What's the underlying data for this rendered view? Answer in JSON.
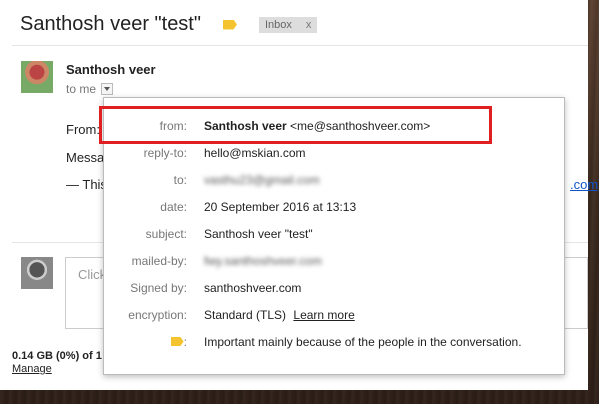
{
  "email": {
    "subject": "Santhosh veer \"test\"",
    "label_chip": "Inbox",
    "label_chip_close": "x",
    "sender_name": "Santhosh veer",
    "to_text": "to me",
    "body_from": "From:",
    "body_message": "Messa",
    "body_this": "— This",
    "body_link_tail": ".com)"
  },
  "reply": {
    "placeholder": "Click"
  },
  "storage": {
    "usage": "0.14 GB (0%) of 1",
    "manage_label": "Manage"
  },
  "details": {
    "rows": [
      {
        "label": "from:",
        "name": "Santhosh veer",
        "email": "<me@santhoshveer.com>"
      },
      {
        "label": "reply-to:",
        "value": "hello@mskian.com"
      },
      {
        "label": "to:",
        "value": "vasthu23@gmail.com"
      },
      {
        "label": "date:",
        "date": "20 September 2016",
        "at": "at",
        "time": "13:13"
      },
      {
        "label": "subject:",
        "value": "Santhosh veer \"test\""
      },
      {
        "label": "mailed-by:",
        "value": "fwy.santhoshveer.com"
      },
      {
        "label": "Signed by:",
        "value": "santhoshveer.com"
      },
      {
        "label": "encryption:",
        "value": "Standard (TLS)",
        "link": "Learn more"
      },
      {
        "label": ":",
        "value": "Important mainly because of the people in the conversation."
      }
    ]
  },
  "colors": {
    "highlight": "#e02020",
    "importance": "#f4c430",
    "link": "#1155cc"
  }
}
